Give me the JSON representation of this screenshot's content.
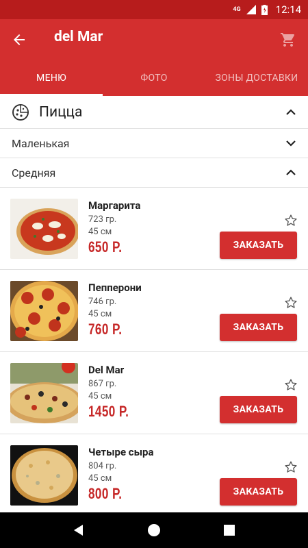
{
  "status_bar": {
    "network": "4G",
    "time": "12:14"
  },
  "app_bar": {
    "title": "del Mar"
  },
  "tabs": [
    {
      "label": "МЕНЮ",
      "active": true
    },
    {
      "label": "ФОТО",
      "active": false
    },
    {
      "label": "ЗОНЫ ДОСТАВКИ",
      "active": false
    }
  ],
  "category": {
    "label": "Пицца",
    "icon": "pizza-icon"
  },
  "subcategories": {
    "small": "Маленькая",
    "medium": "Средняя"
  },
  "items": [
    {
      "name": "Маргарита",
      "weight": "723 гр.",
      "size": "45 см",
      "price": "650 Р.",
      "order_label": "ЗАКАЗАТЬ"
    },
    {
      "name": "Пепперони",
      "weight": "746 гр.",
      "size": "45 см",
      "price": "760 Р.",
      "order_label": "ЗАКАЗАТЬ"
    },
    {
      "name": "Del Mar",
      "weight": "867 гр.",
      "size": "45 см",
      "price": "1450 Р.",
      "order_label": "ЗАКАЗАТЬ"
    },
    {
      "name": "Четыре сыра",
      "weight": "804 гр.",
      "size": "45 см",
      "price": "800 Р.",
      "order_label": "ЗАКАЗАТЬ"
    }
  ],
  "colors": {
    "primary": "#d32f2f",
    "status_bar": "#b71c1c",
    "price": "#c62828"
  }
}
